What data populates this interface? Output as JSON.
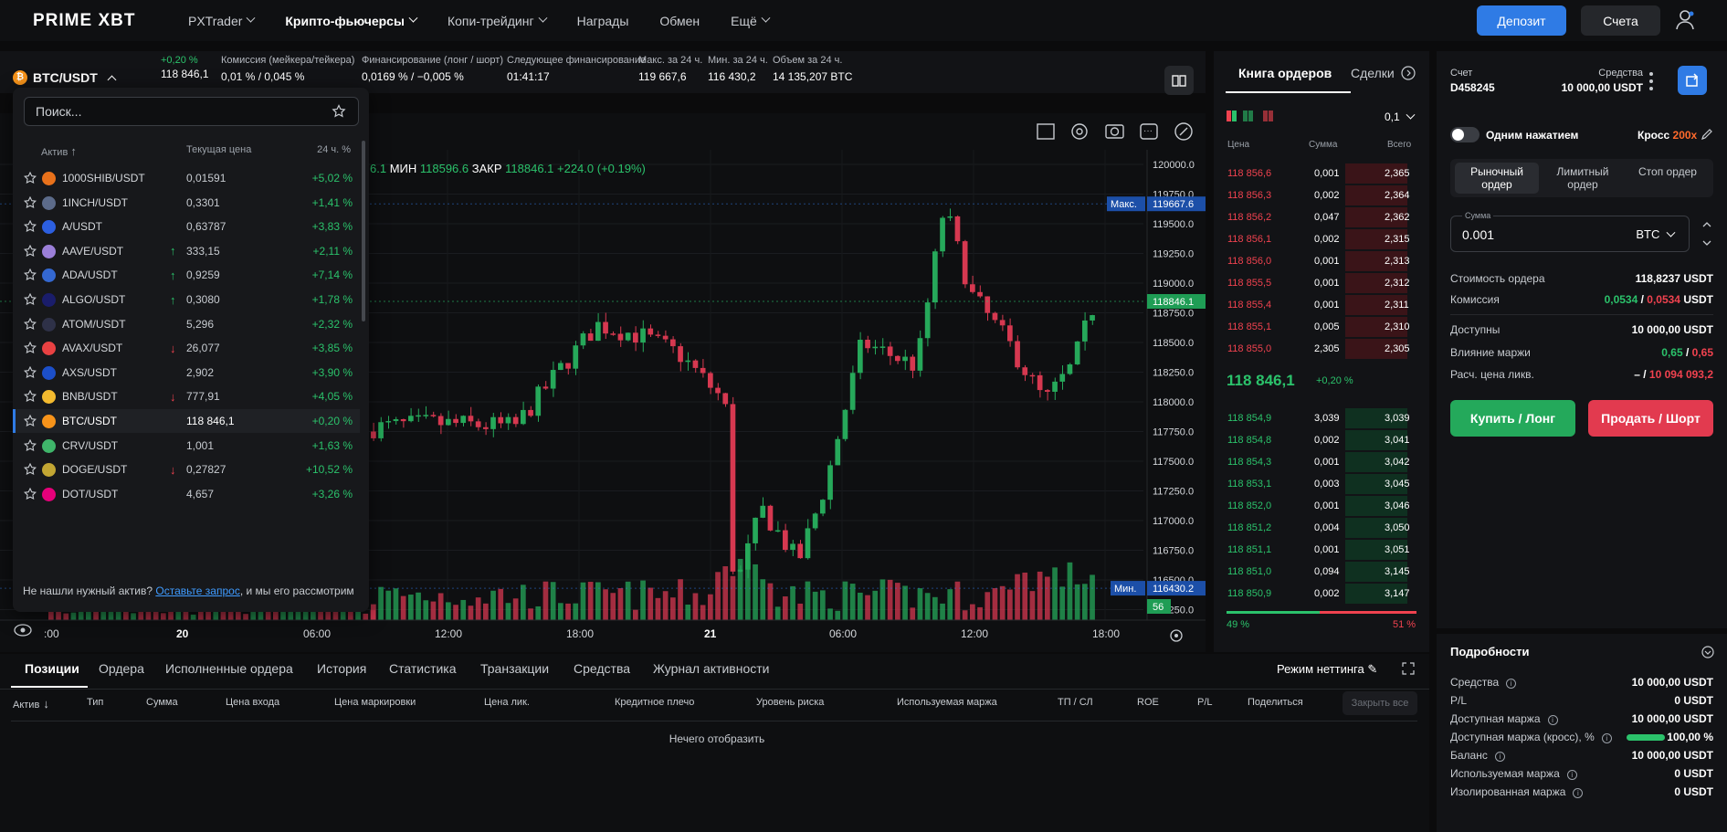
{
  "topbar": {
    "logo": "PRIME XBT",
    "nav": [
      {
        "label": "PXTrader",
        "chev": true
      },
      {
        "label": "Крипто-фьючерсы",
        "chev": true,
        "active": true
      },
      {
        "label": "Копи-трейдинг",
        "chev": true
      },
      {
        "label": "Награды"
      },
      {
        "label": "Обмен"
      },
      {
        "label": "Ещё",
        "chev": true
      }
    ],
    "deposit": "Депозит",
    "accounts": "Счета"
  },
  "ticker": {
    "pair": "BTC/USDT",
    "change": "+0,20 %",
    "price": "118 846,1",
    "stats": [
      {
        "label": "Комиссия (мейкера/тейкера)",
        "value": "0,01 % / 0,045 %"
      },
      {
        "label": "Финансирование (лонг / шорт)",
        "value": "0,0169 % / −0,005 %"
      },
      {
        "label": "Следующее финансирование",
        "value": "01:41:17"
      },
      {
        "label": "Макс. за 24 ч.",
        "value": "119 667,6"
      },
      {
        "label": "Мин. за 24 ч.",
        "value": "116 430,2"
      },
      {
        "label": "Объем за 24 ч.",
        "value": "14 135,207 BTC"
      }
    ]
  },
  "chart": {
    "ohlc": {
      "low_label": "МИН",
      "low": "118596.6",
      "close_label": "ЗАКР",
      "close": "118846.1",
      "change": "+224.0 (+0.19%)",
      "prefix": "6.1"
    },
    "price_ticks": [
      "120000.0",
      "119750.0",
      "119500.0",
      "119250.0",
      "119000.0",
      "118750.0",
      "118500.0",
      "118250.0",
      "118000.0",
      "117750.0",
      "117500.0",
      "117250.0",
      "117000.0",
      "116750.0",
      "116500.0",
      "116250.0"
    ],
    "time_ticks": [
      ":00",
      "20",
      "06:00",
      "12:00",
      "18:00",
      "21",
      "06:00",
      "12:00",
      "18:00"
    ],
    "max_label": "Макс.",
    "max": "119667.6",
    "min_label": "Мин.",
    "min": "116430.2",
    "last": "118846.1",
    "countdown": "56"
  },
  "dropdown": {
    "placeholder": "Поиск...",
    "col_asset": "Актив",
    "col_price": "Текущая цена",
    "col_change": "24 ч. %",
    "rows": [
      {
        "name": "1000SHIB/USDT",
        "price": "0,01591",
        "change": "+5,02 %",
        "color": "#e8711b",
        "arrow": ""
      },
      {
        "name": "1INCH/USDT",
        "price": "0,3301",
        "change": "+1,41 %",
        "color": "#5c6b8a",
        "arrow": ""
      },
      {
        "name": "A/USDT",
        "price": "0,63787",
        "change": "+3,83 %",
        "color": "#2c5fe0",
        "arrow": ""
      },
      {
        "name": "AAVE/USDT",
        "price": "333,15",
        "change": "+2,11 %",
        "color": "#9b7fd8",
        "arrow": "up"
      },
      {
        "name": "ADA/USDT",
        "price": "0,9259",
        "change": "+7,14 %",
        "color": "#3468d1",
        "arrow": "up"
      },
      {
        "name": "ALGO/USDT",
        "price": "0,3080",
        "change": "+1,78 %",
        "color": "#1a1d6b",
        "arrow": "up"
      },
      {
        "name": "ATOM/USDT",
        "price": "5,296",
        "change": "+2,32 %",
        "color": "#2e3148",
        "arrow": ""
      },
      {
        "name": "AVAX/USDT",
        "price": "26,077",
        "change": "+3,85 %",
        "color": "#e84142",
        "arrow": "down"
      },
      {
        "name": "AXS/USDT",
        "price": "2,902",
        "change": "+3,90 %",
        "color": "#1c4fc9",
        "arrow": ""
      },
      {
        "name": "BNB/USDT",
        "price": "777,91",
        "change": "+4,05 %",
        "color": "#f3ba2f",
        "arrow": "down"
      },
      {
        "name": "BTC/USDT",
        "price": "118 846,1",
        "change": "+0,20 %",
        "color": "#f7931a",
        "arrow": "",
        "selected": true
      },
      {
        "name": "CRV/USDT",
        "price": "1,001",
        "change": "+1,63 %",
        "color": "#3fb56a",
        "arrow": ""
      },
      {
        "name": "DOGE/USDT",
        "price": "0,27827",
        "change": "+10,52 %",
        "color": "#c2a633",
        "arrow": "down"
      },
      {
        "name": "DOT/USDT",
        "price": "4,657",
        "change": "+3,26 %",
        "color": "#e6007a",
        "arrow": ""
      }
    ],
    "foot_pre": "Не нашли нужный актив?",
    "foot_link": "Оставьте запрос",
    "foot_post": ", и мы его рассмотрим"
  },
  "orderbook": {
    "tab1": "Книга ордеров",
    "tab2": "Сделки",
    "step": "0,1",
    "h_price": "Цена",
    "h_amount": "Сумма",
    "h_total": "Всего",
    "asks": [
      [
        "118 856,6",
        "0,001",
        "2,365"
      ],
      [
        "118 856,3",
        "0,002",
        "2,364"
      ],
      [
        "118 856,2",
        "0,047",
        "2,362"
      ],
      [
        "118 856,1",
        "0,002",
        "2,315"
      ],
      [
        "118 856,0",
        "0,001",
        "2,313"
      ],
      [
        "118 855,5",
        "0,001",
        "2,312"
      ],
      [
        "118 855,4",
        "0,001",
        "2,311"
      ],
      [
        "118 855,1",
        "0,005",
        "2,310"
      ],
      [
        "118 855,0",
        "2,305",
        "2,305"
      ]
    ],
    "mid": "118 846,1",
    "mid_change": "+0,20 %",
    "bids": [
      [
        "118 854,9",
        "3,039",
        "3,039"
      ],
      [
        "118 854,8",
        "0,002",
        "3,041"
      ],
      [
        "118 854,3",
        "0,001",
        "3,042"
      ],
      [
        "118 853,1",
        "0,003",
        "3,045"
      ],
      [
        "118 852,0",
        "0,001",
        "3,046"
      ],
      [
        "118 851,2",
        "0,004",
        "3,050"
      ],
      [
        "118 851,1",
        "0,001",
        "3,051"
      ],
      [
        "118 851,0",
        "0,094",
        "3,145"
      ],
      [
        "118 850,9",
        "0,002",
        "3,147"
      ]
    ],
    "buy_pct": "49 %",
    "sell_pct": "51 %",
    "buy_frac": 0.49
  },
  "panel": {
    "account_label": "Счет",
    "account": "D458245",
    "funds_label": "Средства",
    "funds": "10 000,00 USDT",
    "oneclick": "Одним нажатием",
    "cross": "Кросс",
    "leverage": "200x",
    "order_types": [
      "Рыночный ордер",
      "Лимитный ордер",
      "Стоп ордер"
    ],
    "amount_label": "Сумма",
    "amount": "0.001",
    "currency": "BTC",
    "order_value_label": "Стоимость ордера",
    "order_value": "118,8237 USDT",
    "fee_label": "Комиссия",
    "fee_buy": "0,0534",
    "fee_sell": "0,0534",
    "fee_unit": "USDT",
    "avail_label": "Доступны",
    "avail": "10 000,00 USDT",
    "margin_label": "Влияние маржи",
    "margin_buy": "0,65",
    "margin_sell": "0,65",
    "liq_label": "Расч. цена ликв.",
    "liq_buy": "–",
    "liq_sell": "10 094 093,2",
    "buy": "Купить / Лонг",
    "sell": "Продать / Шорт"
  },
  "details": {
    "title": "Подробности",
    "rows": [
      {
        "label": "Средства",
        "value": "10 000,00 USDT"
      },
      {
        "label": "P/L",
        "value": "0 USDT"
      },
      {
        "label": "Доступная маржа",
        "value": "10 000,00 USDT"
      },
      {
        "label": "Доступная маржа (кросс), %",
        "value": "100,00 %",
        "bar": 1.0
      },
      {
        "label": "Баланс",
        "value": "10 000,00 USDT"
      },
      {
        "label": "Используемая маржа",
        "value": "0 USDT"
      },
      {
        "label": "Изолированная маржа",
        "value": "0 USDT"
      }
    ]
  },
  "bottom": {
    "tabs": [
      "Позиции",
      "Ордера",
      "Исполненные ордера",
      "История",
      "Статистика",
      "Транзакции",
      "Средства",
      "Журнал активности"
    ],
    "netting": "Режим неттинга",
    "columns": [
      "Актив",
      "Тип",
      "Сумма",
      "Цена входа",
      "Цена маркировки",
      "Цена лик.",
      "Кредитное плечо",
      "Уровень риска",
      "Используемая маржа",
      "ТП / СЛ",
      "ROE",
      "P/L",
      "Поделиться"
    ],
    "close_all": "Закрыть все",
    "empty": "Нечего отобразить"
  }
}
